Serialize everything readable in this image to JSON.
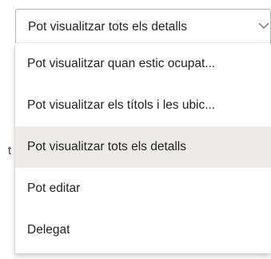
{
  "dropdown": {
    "selected_label": "Pot visualitzar tots els detalls",
    "icon": "chevron-down-icon",
    "options": [
      {
        "label": "Pot visualitzar quan estic ocupat..."
      },
      {
        "label": "Pot visualitzar els títols i les ubic..."
      },
      {
        "label": "Pot visualitzar tots els detalls"
      },
      {
        "label": "Pot editar"
      },
      {
        "label": "Delegat"
      }
    ],
    "selected_index": 2
  },
  "background": {
    "partial_glyph": "t"
  },
  "colors": {
    "selected_background": "#edebe9",
    "text": "#252423",
    "border": "#b3b3b3"
  }
}
